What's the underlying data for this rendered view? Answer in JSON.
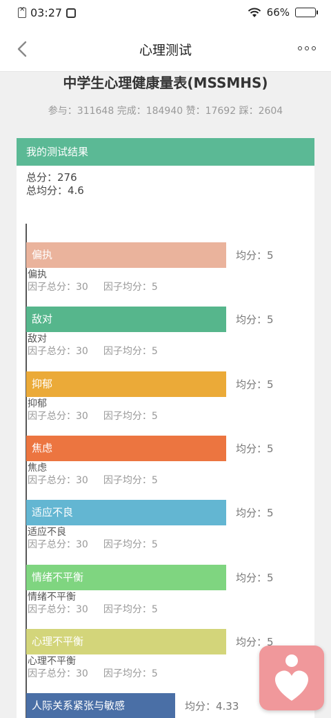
{
  "status": {
    "time": "03:27",
    "battery": "66%"
  },
  "nav": {
    "title": "心理测试"
  },
  "test": {
    "title": "中学生心理健康量表(MSSMHS)",
    "stats": "参与：311648 完成：184940 赞：17692 踩：2604"
  },
  "result": {
    "header": "我的测试结果",
    "total": "总分：276",
    "total_avg": "总均分：4.6",
    "factors": [
      {
        "name": "偏执",
        "avg": "均分：5",
        "total": "因子总分：30",
        "factor_avg": "因子均分：5",
        "color": "#eab39c"
      },
      {
        "name": "敌对",
        "avg": "均分：5",
        "total": "因子总分：30",
        "factor_avg": "因子均分：5",
        "color": "#56b68c"
      },
      {
        "name": "抑郁",
        "avg": "均分：5",
        "total": "因子总分：30",
        "factor_avg": "因子均分：5",
        "color": "#ebaa38"
      },
      {
        "name": "焦虑",
        "avg": "均分：5",
        "total": "因子总分：30",
        "factor_avg": "因子均分：5",
        "color": "#ec7540"
      },
      {
        "name": "适应不良",
        "avg": "均分：5",
        "total": "因子总分：30",
        "factor_avg": "因子均分：5",
        "color": "#63b6d2"
      },
      {
        "name": "情绪不平衡",
        "avg": "均分：5",
        "total": "因子总分：30",
        "factor_avg": "因子均分：5",
        "color": "#7fd580"
      },
      {
        "name": "心理不平衡",
        "avg": "均分：5",
        "total": "因子总分：30",
        "factor_avg": "因子均分：5",
        "color": "#d3d57a"
      },
      {
        "name": "人际关系紧张与敏感",
        "avg": "均分：4.33",
        "total": "",
        "factor_avg": "",
        "color": "#4a6fa6"
      }
    ],
    "max_avg": 5,
    "factor_avg_values": [
      5,
      5,
      5,
      5,
      5,
      5,
      5,
      4.33
    ]
  },
  "icons": {
    "back": "chevron-left-icon",
    "more": "more-dots-icon",
    "float": "heart-person-icon"
  }
}
